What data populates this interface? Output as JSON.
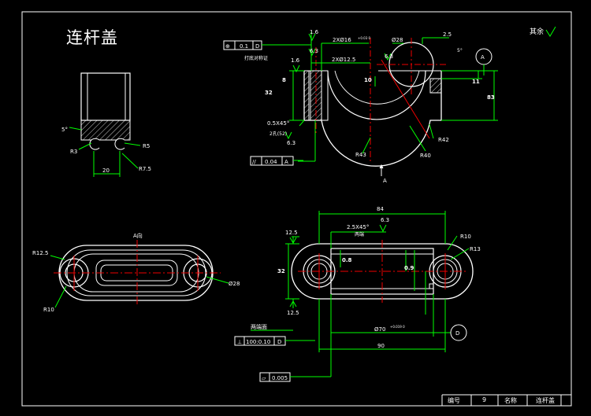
{
  "drawing": {
    "title": "连杆盖",
    "roughness_note": "其余",
    "title_block": {
      "number_label": "编号",
      "number_value": "9",
      "name_label": "名称",
      "name_value": "连杆盖"
    }
  },
  "front_view": {
    "labels": {
      "tol_box_sym": "⊕",
      "tol_box_val": "0.1",
      "tol_box_ref": "D",
      "r16a": "1.6",
      "hole_2x16": "2XØ16",
      "hole_2x16_tol": "+0.03 0",
      "d28": "Ø28",
      "d25": "2.5",
      "r63a": "6.3",
      "r63b": "6.3",
      "note_mark": "打底对称证",
      "r16b": "1.6",
      "hole_2x12": "2XØ12.5",
      "angle5": "5°",
      "callout_a": "A",
      "dim8": "8",
      "dim10": "10",
      "dim11": "11",
      "dim32": "32",
      "dim83": "83",
      "chamfer": "0.5X45°",
      "holes_note": "2孔(52)",
      "r63c": "6.3",
      "r42": "R42",
      "r43": "R43",
      "r40": "R40",
      "parallel_sym": "//",
      "parallel_val": "0.04",
      "parallel_ref": "A",
      "arrow_a": "A"
    }
  },
  "section_view": {
    "labels": {
      "angle5": "5°",
      "r3": "R3",
      "r5": "R5",
      "dim20": "20",
      "r75": "R7.5"
    }
  },
  "bottom_view": {
    "labels": {
      "view_a": "A向",
      "r125": "R12.5",
      "d28": "Ø28",
      "r10": "R10"
    }
  },
  "right_view": {
    "labels": {
      "dim84": "84",
      "r63": "6.3",
      "r125a": "12.5",
      "chamfer": "2.5X45°",
      "both_ends": "两端",
      "r10": "R10",
      "r13": "R13",
      "r32": "32",
      "r08": "0.8",
      "r09": "0.9",
      "r125b": "12.5",
      "d70": "Ø70",
      "d70_tol": "+0.019 0",
      "both_surf": "两端面",
      "d_ref": "D",
      "tol_sym": "⊥",
      "tol_val": "100:0.10",
      "tol_ref": "D",
      "dim90": "90",
      "flat_sym": "⏥",
      "flat_val": "0.005"
    }
  }
}
